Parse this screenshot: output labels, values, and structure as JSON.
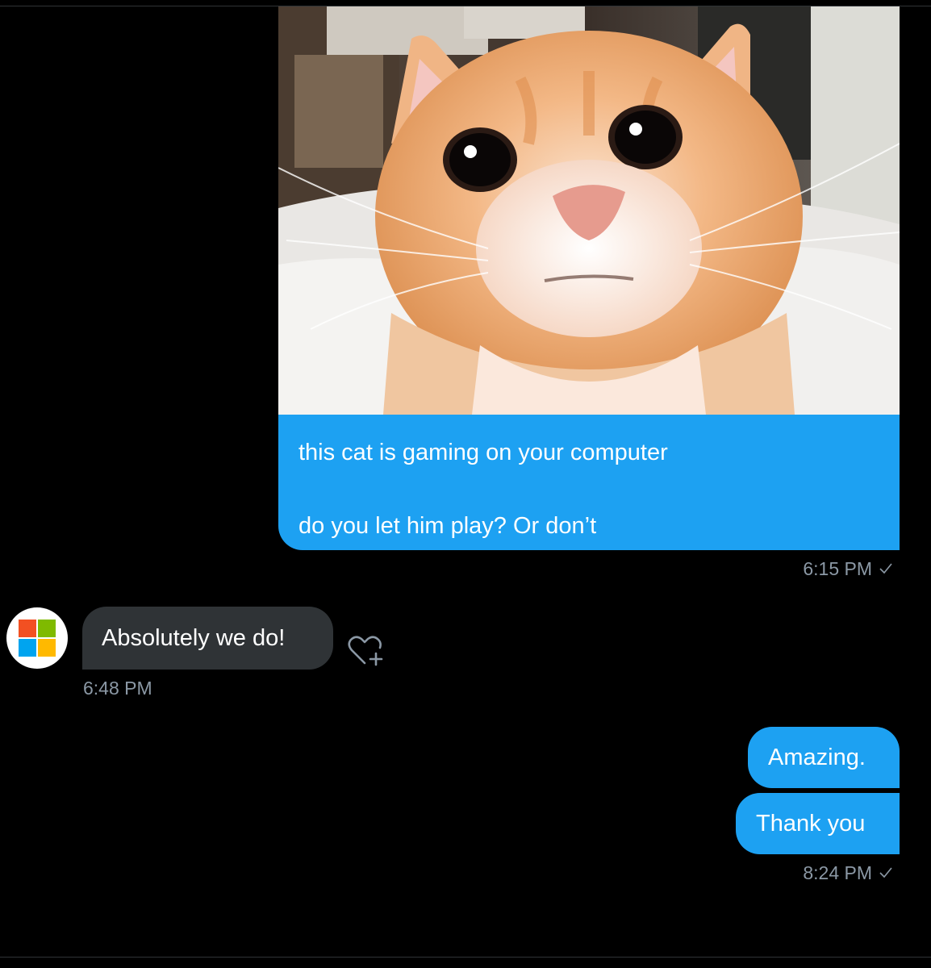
{
  "colors": {
    "background": "#000000",
    "outgoing_bubble": "#1da1f2",
    "incoming_bubble": "#2f3336",
    "timestamp": "#8b98a5",
    "divider": "#2f3336"
  },
  "messages": {
    "outgoing_media": {
      "image_description_icon": "cat-photo",
      "caption_line1": "this cat is gaming on your computer",
      "caption_line2": "do you let him play? Or don’t",
      "timestamp": "6:15 PM"
    },
    "incoming": {
      "avatar_icon": "microsoft-logo-icon",
      "text": "Absolutely we do!",
      "timestamp": "6:48 PM",
      "reaction_icon": "heart-plus-icon"
    },
    "outgoing_text": [
      {
        "text": "Amazing."
      },
      {
        "text": "Thank you"
      }
    ],
    "outgoing_text_timestamp": "8:24 PM"
  }
}
